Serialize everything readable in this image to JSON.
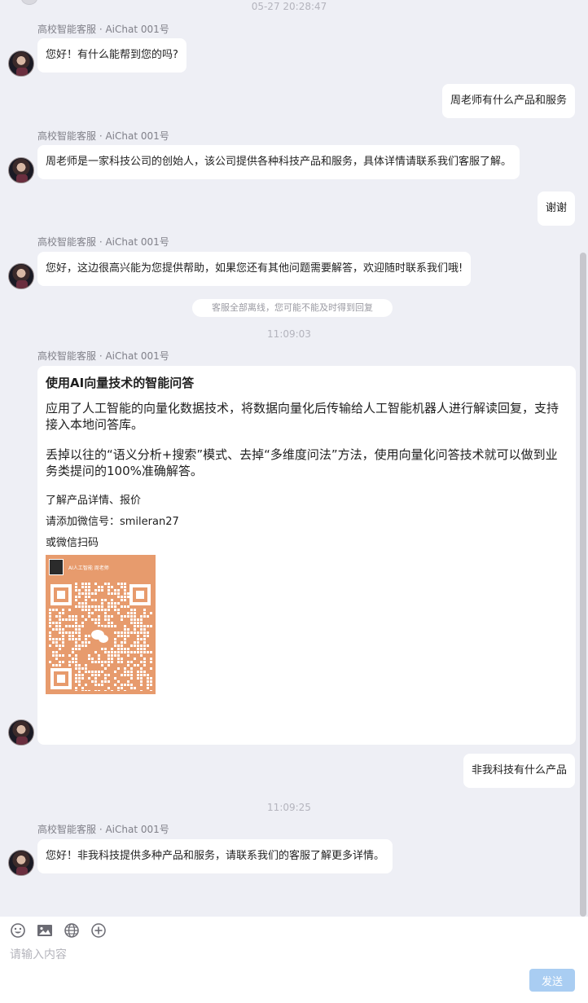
{
  "messages": {
    "ts1": "05-27 20:28:47",
    "sender": "高校智能客服 · AiChat 001号",
    "m1": "您好！有什么能帮到您的吗?",
    "u1": "周老师有什么产品和服务",
    "m2": "周老师是一家科技公司的创始人，该公司提供各种科技产品和服务，具体详情请联系我们客服了解。",
    "u2": "谢谢",
    "m3": "您好，这边很高兴能为您提供帮助，如果您还有其他问题需要解答，欢迎随时联系我们哦!",
    "notice": "客服全部离线，您可能不能及时得到回复",
    "ts2": "11:09:03",
    "card": {
      "title": "使用AI向量技术的智能问答",
      "p1": "应用了人工智能的向量化数据技术，将数据向量化后传输给人工智能机器人进行解读回复，支持接入本地问答库。",
      "p2": "丢掉以往的“语义分析+搜索”模式、去掉“多维度问法”方法，使用向量化问答技术就可以做到业务类提问的100%准确解答。",
      "line1": "了解产品详情、报价",
      "line2": "请添加微信号：smileran27",
      "line3": "或微信扫码",
      "qr_name": "AI人工智能 周老师"
    },
    "u3": "非我科技有什么产品",
    "ts3": "11:09:25",
    "m4": "您好！非我科技提供多种产品和服务，请联系我们的客服了解更多详情。"
  },
  "input": {
    "placeholder": "请输入内容",
    "send_label": "发送"
  },
  "colors": {
    "background": "#eeeff5",
    "bubble": "#ffffff",
    "send_button": "#a9cdf2",
    "qr_background": "#e79b6d"
  },
  "icons": [
    "emoji-icon",
    "image-icon",
    "globe-icon",
    "plus-circle-icon"
  ]
}
